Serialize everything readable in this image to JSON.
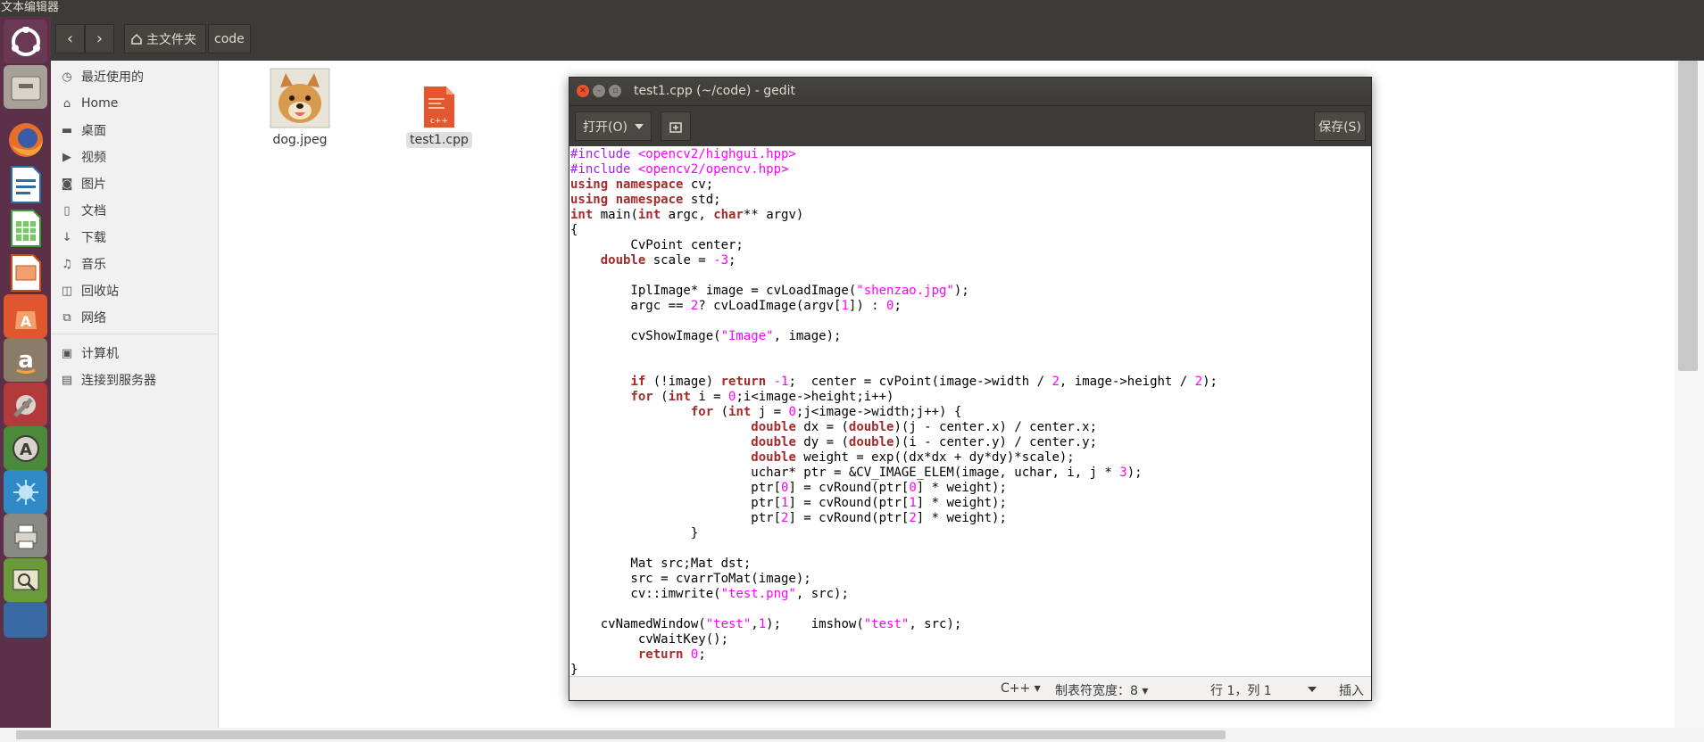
{
  "topbar": {
    "title": "文本编辑器"
  },
  "launcher": {
    "items": [
      {
        "icon": "ubuntu-logo-icon",
        "color": "#6a3a55"
      },
      {
        "icon": "files-icon",
        "color": "#a5a098"
      },
      {
        "icon": "firefox-icon",
        "color": "#e76f2a"
      },
      {
        "icon": "libreoffice-writer-icon",
        "color": "#2e6ea8"
      },
      {
        "icon": "libreoffice-calc-icon",
        "color": "#3d9a3a"
      },
      {
        "icon": "libreoffice-impress-icon",
        "color": "#c9521e"
      },
      {
        "icon": "software-center-icon",
        "color": "#e0572e"
      },
      {
        "icon": "amazon-icon",
        "color": "#8b7c68"
      },
      {
        "icon": "system-settings-icon",
        "color": "#b23a3a"
      },
      {
        "icon": "software-updater-icon",
        "color": "#4b8a3a"
      },
      {
        "icon": "screenshot-icon",
        "color": "#2f8ac5"
      },
      {
        "icon": "printer-icon",
        "color": "#8a8a84"
      },
      {
        "icon": "system-monitor-icon",
        "color": "#6b9a3a"
      },
      {
        "icon": "trash-icon",
        "color": "#3a6aa5"
      }
    ]
  },
  "nautilus": {
    "back_icon": "‹",
    "forward_icon": "›",
    "breadcrumbs": [
      {
        "label": "主文件夹",
        "icon": "home-icon"
      },
      {
        "label": "code"
      }
    ],
    "sidebar": [
      {
        "label": "最近使用的",
        "icon": "clock-icon",
        "glyph": "◷"
      },
      {
        "label": "Home",
        "icon": "home-icon",
        "glyph": "⌂"
      },
      {
        "label": "桌面",
        "icon": "folder-icon",
        "glyph": "▬"
      },
      {
        "label": "视频",
        "icon": "video-icon",
        "glyph": "▶"
      },
      {
        "label": "图片",
        "icon": "camera-icon",
        "glyph": "◙"
      },
      {
        "label": "文档",
        "icon": "document-icon",
        "glyph": "▯"
      },
      {
        "label": "下载",
        "icon": "download-icon",
        "glyph": "↓"
      },
      {
        "label": "音乐",
        "icon": "music-icon",
        "glyph": "♫"
      },
      {
        "label": "回收站",
        "icon": "trash-icon",
        "glyph": "◫"
      },
      {
        "label": "网络",
        "icon": "network-icon",
        "glyph": "⧉"
      },
      {
        "label": "计算机",
        "icon": "computer-icon",
        "glyph": "▣"
      },
      {
        "label": "连接到服务器",
        "icon": "server-icon",
        "glyph": "▤"
      }
    ],
    "files": [
      {
        "name": "dog.jpeg",
        "icon": "dog-image-thumbnail"
      },
      {
        "name": "test1.cpp",
        "icon": "cpp-file-icon"
      }
    ]
  },
  "gedit": {
    "title": "test1.cpp (~/code) - gedit",
    "open_label": "打开(O)",
    "save_label": "保存(S)",
    "code_lines": [
      [
        [
          "pp",
          "#include "
        ],
        [
          "str",
          "<opencv2/highgui.hpp>"
        ]
      ],
      [
        [
          "pp",
          "#include "
        ],
        [
          "str",
          "<opencv2/opencv.hpp>"
        ]
      ],
      [
        [
          "kw",
          "using"
        ],
        [
          "t",
          " "
        ],
        [
          "kw",
          "namespace"
        ],
        [
          "t",
          " cv;"
        ]
      ],
      [
        [
          "kw",
          "using"
        ],
        [
          "t",
          " "
        ],
        [
          "kw",
          "namespace"
        ],
        [
          "t",
          " std;"
        ]
      ],
      [
        [
          "kw",
          "int"
        ],
        [
          "t",
          " main("
        ],
        [
          "kw",
          "int"
        ],
        [
          "t",
          " argc, "
        ],
        [
          "kw",
          "char"
        ],
        [
          "t",
          "** argv)"
        ]
      ],
      [
        [
          "t",
          "{"
        ]
      ],
      [
        [
          "t",
          "        CvPoint center;"
        ]
      ],
      [
        [
          "t",
          "    "
        ],
        [
          "kw",
          "double"
        ],
        [
          "t",
          " scale = "
        ],
        [
          "num",
          "-3"
        ],
        [
          "t",
          ";"
        ]
      ],
      [
        [
          "t",
          ""
        ]
      ],
      [
        [
          "t",
          "        IplImage* image = cvLoadImage("
        ],
        [
          "str",
          "\"shenzao.jpg\""
        ],
        [
          "t",
          ");"
        ]
      ],
      [
        [
          "t",
          "        argc == "
        ],
        [
          "num",
          "2"
        ],
        [
          "t",
          "? cvLoadImage(argv["
        ],
        [
          "num",
          "1"
        ],
        [
          "t",
          "]) : "
        ],
        [
          "num",
          "0"
        ],
        [
          "t",
          ";"
        ]
      ],
      [
        [
          "t",
          ""
        ]
      ],
      [
        [
          "t",
          "        cvShowImage("
        ],
        [
          "str",
          "\"Image\""
        ],
        [
          "t",
          ", image);"
        ]
      ],
      [
        [
          "t",
          ""
        ]
      ],
      [
        [
          "t",
          ""
        ]
      ],
      [
        [
          "t",
          "        "
        ],
        [
          "kw",
          "if"
        ],
        [
          "t",
          " (!image) "
        ],
        [
          "kw",
          "return"
        ],
        [
          "t",
          " "
        ],
        [
          "num",
          "-1"
        ],
        [
          "t",
          ";  center = cvPoint(image->width / "
        ],
        [
          "num",
          "2"
        ],
        [
          "t",
          ", image->height / "
        ],
        [
          "num",
          "2"
        ],
        [
          "t",
          ");"
        ]
      ],
      [
        [
          "t",
          "        "
        ],
        [
          "kw",
          "for"
        ],
        [
          "t",
          " ("
        ],
        [
          "kw",
          "int"
        ],
        [
          "t",
          " i = "
        ],
        [
          "num",
          "0"
        ],
        [
          "t",
          ";i<image->height;i++)"
        ]
      ],
      [
        [
          "t",
          "                "
        ],
        [
          "kw",
          "for"
        ],
        [
          "t",
          " ("
        ],
        [
          "kw",
          "int"
        ],
        [
          "t",
          " j = "
        ],
        [
          "num",
          "0"
        ],
        [
          "t",
          ";j<image->width;j++) {"
        ]
      ],
      [
        [
          "t",
          "                        "
        ],
        [
          "kw",
          "double"
        ],
        [
          "t",
          " dx = ("
        ],
        [
          "kw",
          "double"
        ],
        [
          "t",
          ")(j - center.x) / center.x;"
        ]
      ],
      [
        [
          "t",
          "                        "
        ],
        [
          "kw",
          "double"
        ],
        [
          "t",
          " dy = ("
        ],
        [
          "kw",
          "double"
        ],
        [
          "t",
          ")(i - center.y) / center.y;"
        ]
      ],
      [
        [
          "t",
          "                        "
        ],
        [
          "kw",
          "double"
        ],
        [
          "t",
          " weight = exp((dx*dx + dy*dy)*scale);"
        ]
      ],
      [
        [
          "t",
          "                        uchar* ptr = &CV_IMAGE_ELEM(image, uchar, i, j * "
        ],
        [
          "num",
          "3"
        ],
        [
          "t",
          ");"
        ]
      ],
      [
        [
          "t",
          "                        ptr["
        ],
        [
          "num",
          "0"
        ],
        [
          "t",
          "] = cvRound(ptr["
        ],
        [
          "num",
          "0"
        ],
        [
          "t",
          "] * weight);"
        ]
      ],
      [
        [
          "t",
          "                        ptr["
        ],
        [
          "num",
          "1"
        ],
        [
          "t",
          "] = cvRound(ptr["
        ],
        [
          "num",
          "1"
        ],
        [
          "t",
          "] * weight);"
        ]
      ],
      [
        [
          "t",
          "                        ptr["
        ],
        [
          "num",
          "2"
        ],
        [
          "t",
          "] = cvRound(ptr["
        ],
        [
          "num",
          "2"
        ],
        [
          "t",
          "] * weight);"
        ]
      ],
      [
        [
          "t",
          "                }"
        ]
      ],
      [
        [
          "t",
          ""
        ]
      ],
      [
        [
          "t",
          "        Mat src;Mat dst;"
        ]
      ],
      [
        [
          "t",
          "        src = cvarrToMat(image);"
        ]
      ],
      [
        [
          "t",
          "        cv::imwrite("
        ],
        [
          "str",
          "\"test.png\""
        ],
        [
          "t",
          ", src);"
        ]
      ],
      [
        [
          "t",
          ""
        ]
      ],
      [
        [
          "t",
          "    cvNamedWindow("
        ],
        [
          "str",
          "\"test\""
        ],
        [
          "t",
          ","
        ],
        [
          "num",
          "1"
        ],
        [
          "t",
          ");    imshow("
        ],
        [
          "str",
          "\"test\""
        ],
        [
          "t",
          ", src);"
        ]
      ],
      [
        [
          "t",
          "         cvWaitKey();"
        ]
      ],
      [
        [
          "t",
          "         "
        ],
        [
          "kw",
          "return"
        ],
        [
          "t",
          " "
        ],
        [
          "num",
          "0"
        ],
        [
          "t",
          ";"
        ]
      ],
      [
        [
          "t",
          "}"
        ]
      ]
    ],
    "status": {
      "language": "C++ ▾",
      "tab_width": "制表符宽度：8 ▾",
      "position": "行 1，列 1",
      "mode": "插入"
    }
  },
  "colors": {
    "keyword": "#a52a2a",
    "preprocessor": "#a020f0",
    "string": "#ff00ff",
    "close_button": "#e8532d",
    "window_button": "#8a8882"
  }
}
